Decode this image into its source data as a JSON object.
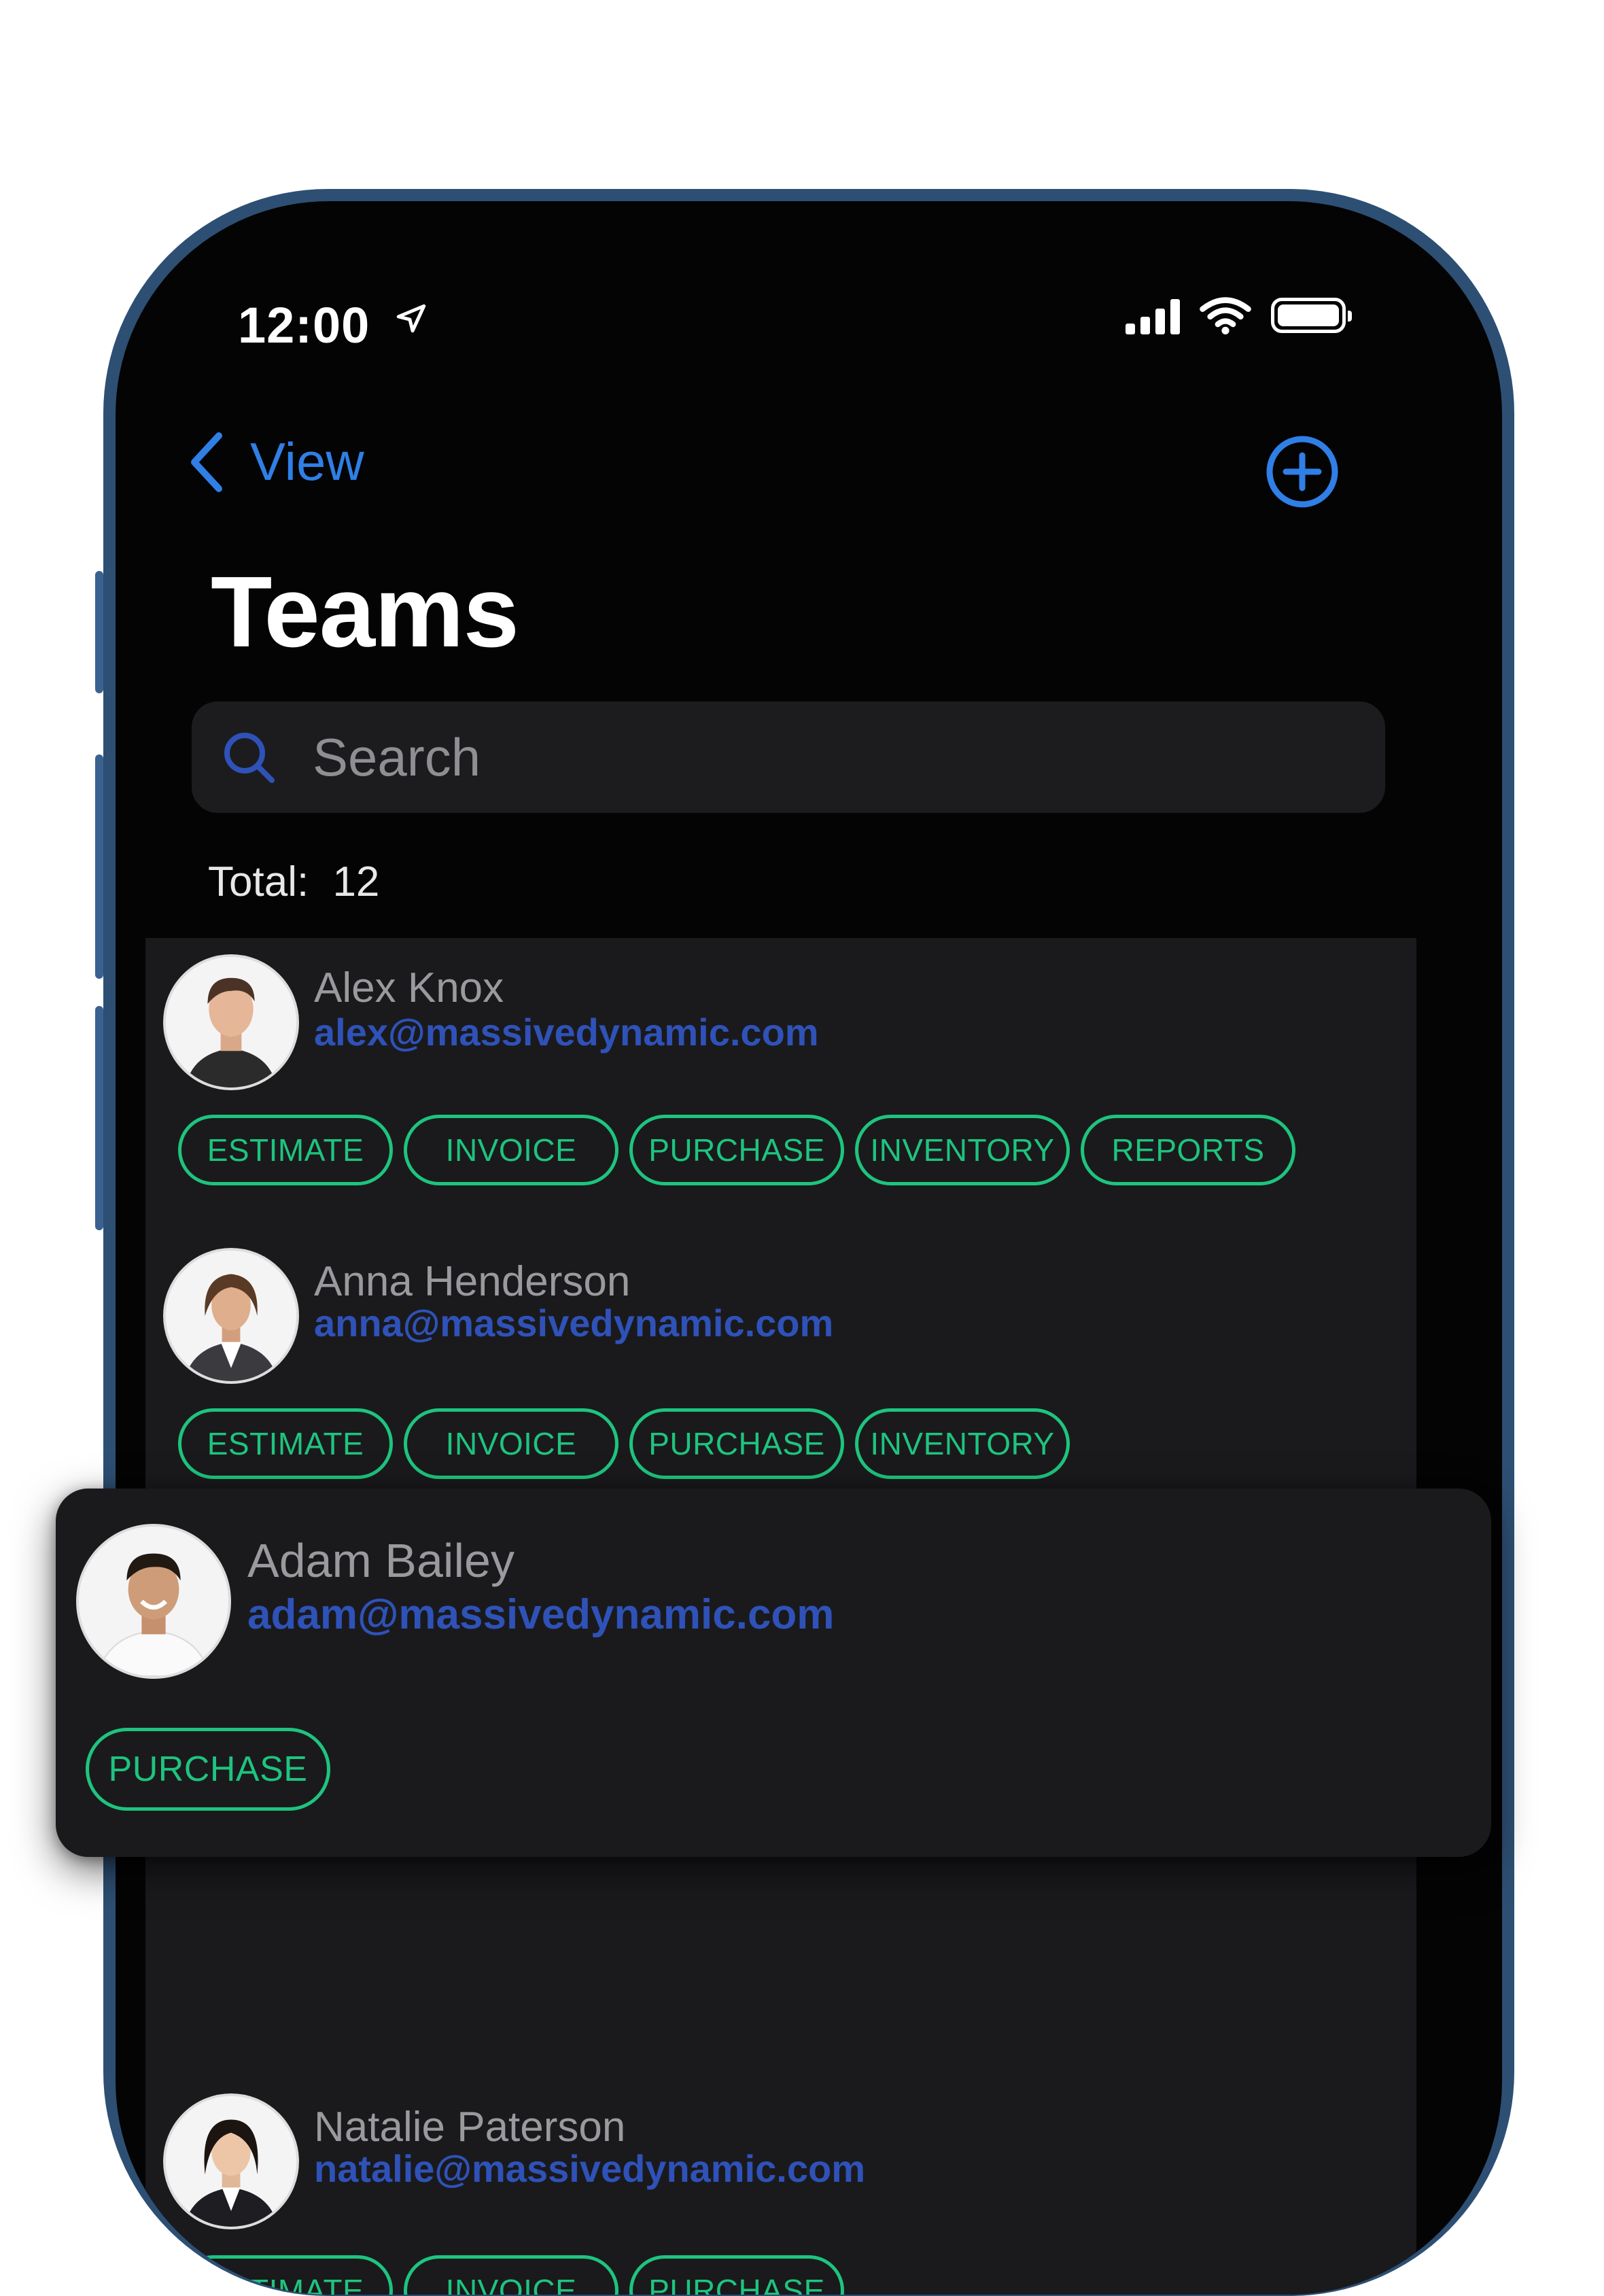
{
  "status_bar": {
    "time": "12:00"
  },
  "nav": {
    "back_label": "View"
  },
  "page": {
    "title": "Teams"
  },
  "search": {
    "placeholder": "Search"
  },
  "summary": {
    "total_label": "Total:",
    "total_value": "12"
  },
  "members": [
    {
      "name": "Alex Knox",
      "email": "alex@massivedynamic.com",
      "tags": [
        "ESTIMATE",
        "INVOICE",
        "PURCHASE",
        "INVENTORY",
        "REPORTS"
      ]
    },
    {
      "name": "Anna Henderson",
      "email": "anna@massivedynamic.com",
      "tags": [
        "ESTIMATE",
        "INVOICE",
        "PURCHASE",
        "INVENTORY"
      ]
    },
    {
      "name": "Adam Bailey",
      "email": "adam@massivedynamic.com",
      "tags": [
        "PURCHASE"
      ]
    },
    {
      "name": "Natalie Paterson",
      "email": "natalie@massivedynamic.com",
      "tags": [
        "ESTIMATE",
        "INVOICE",
        "PURCHASE"
      ]
    }
  ],
  "colors": {
    "accent_blue": "#2f7fe6",
    "tag_green": "#1ec47e",
    "email_blue": "#2f52b8",
    "card_bg": "#1a1a1d"
  },
  "icons": [
    "location-arrow-icon",
    "signal-icon",
    "wifi-icon",
    "battery-icon",
    "chevron-left-icon",
    "add-circle-icon",
    "search-icon",
    "avatar-photo"
  ]
}
